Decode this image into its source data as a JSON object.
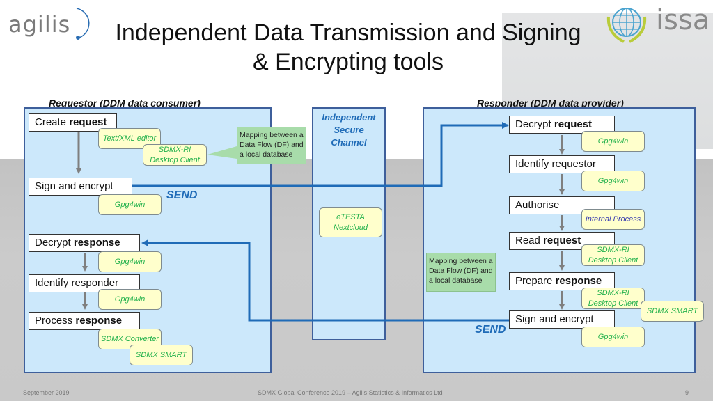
{
  "slide": {
    "title_line1": "Independent Data Transmission and Signing",
    "title_line2": "& Encrypting tools",
    "logos": {
      "left": "agilis",
      "right": "issa"
    }
  },
  "requestor": {
    "label": "Requestor (DDM data consumer)",
    "steps": [
      {
        "plain": "Create ",
        "bold": "request"
      },
      {
        "plain": "Sign and encrypt",
        "bold": ""
      },
      {
        "plain": "Decrypt ",
        "bold": "response"
      },
      {
        "plain": "Identify responder",
        "bold": ""
      },
      {
        "plain": "Process ",
        "bold": "response"
      }
    ],
    "tools": {
      "text_xml_editor": "Text/XML editor",
      "sdmx_ri_1": "SDMX-RI",
      "sdmx_ri_2": "Desktop Client",
      "gpg_sign": "Gpg4win",
      "gpg_decrypt": "Gpg4win",
      "gpg_identify": "Gpg4win",
      "sdmx_converter": "SDMX Converter",
      "sdmx_smart": "SDMX SMART"
    },
    "callout": [
      "Mapping between a",
      "Data Flow (DF) and",
      "a local database"
    ],
    "send_label": "SEND"
  },
  "channel": {
    "title": [
      "Independent",
      "Secure",
      "Channel"
    ],
    "tool": [
      "eTESTA",
      "Nextcloud"
    ]
  },
  "responder": {
    "label": "Responder (DDM data provider)",
    "steps": [
      {
        "plain": "Decrypt ",
        "bold": "request"
      },
      {
        "plain": "Identify requestor",
        "bold": ""
      },
      {
        "plain": "Authorise",
        "bold": ""
      },
      {
        "plain": "Read ",
        "bold": "request"
      },
      {
        "plain": "Prepare ",
        "bold": "response"
      },
      {
        "plain": "Sign and encrypt",
        "bold": ""
      }
    ],
    "tools": {
      "gpg_decrypt": "Gpg4win",
      "gpg_identify": "Gpg4win",
      "internal_process": "Internal Process",
      "sdmx_ri_read_1": "SDMX-RI",
      "sdmx_ri_read_2": "Desktop Client",
      "sdmx_ri_prepare_1": "SDMX-RI",
      "sdmx_ri_prepare_2": "Desktop Client",
      "sdmx_smart": "SDMX SMART",
      "gpg_sign": "Gpg4win"
    },
    "callout": [
      "Mapping between a",
      "Data Flow (DF) and",
      "a local database"
    ],
    "send_label": "SEND"
  },
  "colors": {
    "panel_fill": "#cce8fb",
    "panel_border": "#3e5f9b",
    "flow_arrow": "#1f6bb7",
    "step_arrow": "#7f7f7f",
    "tool_fill": "#ffffcc",
    "tool_text": "#22b14c",
    "callout_fill": "#a8dcaa"
  },
  "footer": {
    "date": "September 2019",
    "center": "SDMX Global Conference 2019 – Agilis Statistics & Informatics Ltd",
    "page_number": "9"
  }
}
